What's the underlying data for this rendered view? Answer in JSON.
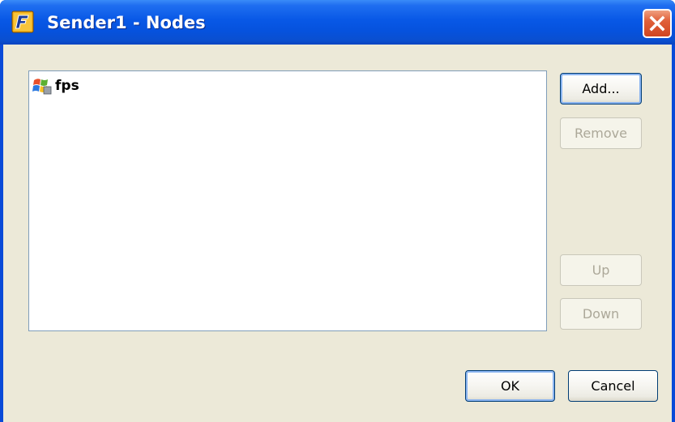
{
  "window": {
    "title": "Sender1 - Nodes",
    "app_icon": "app-logo-icon",
    "close_icon": "close-icon"
  },
  "node_list": {
    "items": [
      {
        "label": "fps",
        "icon": "windows-computer-icon"
      }
    ]
  },
  "side_buttons": {
    "add_label": "Add...",
    "remove_label": "Remove",
    "up_label": "Up",
    "down_label": "Down"
  },
  "footer": {
    "ok_label": "OK",
    "cancel_label": "Cancel"
  },
  "colors": {
    "titlebar": "#0858e6",
    "dialog_face": "#ece9d8",
    "close_button": "#e0603a",
    "disabled_text": "#aca899"
  }
}
